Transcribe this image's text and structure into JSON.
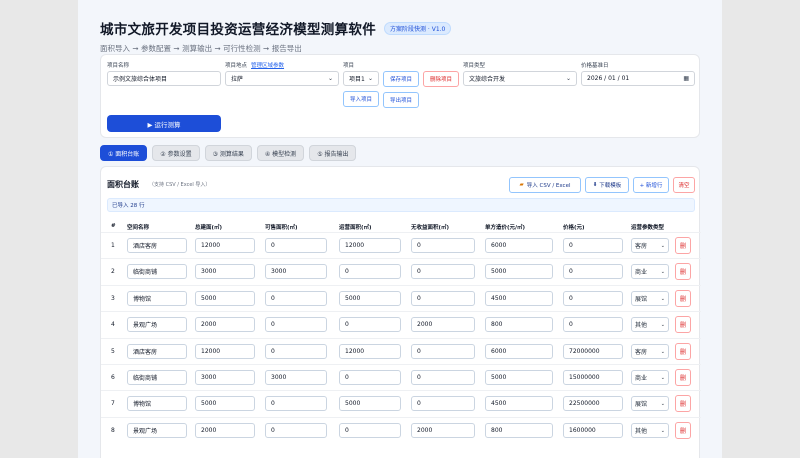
{
  "header": {
    "title": "城市文旅开发项目投资运营经济模型测算软件",
    "version": "方案阶段快测 · V1.0",
    "subtitle": "面积导入 ➞ 参数配置 ➞ 测算输出 ➞ 可行性检测 ➞ 报告导出"
  },
  "form": {
    "project_name_label": "项目名称",
    "project_name_value": "示例文旅综合体项目",
    "region_label": "项目地点",
    "region_link": "管理区域参数",
    "region_value": "拉萨",
    "project_label": "项目",
    "project_value": "项目1",
    "save_label": "保存项目",
    "delete_label": "删除项目",
    "import_label": "导入项目",
    "export_label": "导出项目",
    "type_label": "项目类型",
    "type_value": "文旅综合开发",
    "date_label": "价格基准日",
    "date_value": "2026 / 01 / 01",
    "run_label": "▶ 运行测算"
  },
  "tabs": [
    {
      "label": "① 面积台账",
      "active": true
    },
    {
      "label": "② 参数设置",
      "active": false
    },
    {
      "label": "③ 测算结果",
      "active": false
    },
    {
      "label": "④ 模型检测",
      "active": false
    },
    {
      "label": "⑤ 报告输出",
      "active": false
    }
  ],
  "table": {
    "title": "面积台账",
    "hint": "（支持 CSV / Excel 导入）",
    "import_btn": "导入 CSV / Excel",
    "template_btn": "下载模板",
    "add_btn": "+ 新增行",
    "clear_btn": "清空",
    "imported_msg": "已导入 28 行",
    "columns": [
      "#",
      "空间名称",
      "总建面(㎡)",
      "可售面积(㎡)",
      "运营面积(㎡)",
      "无收益面积(㎡)",
      "单方造价(元/㎡)",
      "价格(元)",
      "运营参数类型",
      ""
    ],
    "delete_label": "删",
    "rows": [
      {
        "no": "1",
        "name": "酒店客房",
        "gfa": "12000",
        "sale": "0",
        "op": "12000",
        "non": "0",
        "cost": "6000",
        "price": "0",
        "type": "客房"
      },
      {
        "no": "2",
        "name": "临街商铺",
        "gfa": "3000",
        "sale": "3000",
        "op": "0",
        "non": "0",
        "cost": "5000",
        "price": "0",
        "type": "商业"
      },
      {
        "no": "3",
        "name": "博物馆",
        "gfa": "5000",
        "sale": "0",
        "op": "5000",
        "non": "0",
        "cost": "4500",
        "price": "0",
        "type": "展馆"
      },
      {
        "no": "4",
        "name": "景观广场",
        "gfa": "2000",
        "sale": "0",
        "op": "0",
        "non": "2000",
        "cost": "800",
        "price": "0",
        "type": "其他"
      },
      {
        "no": "5",
        "name": "酒店客房",
        "gfa": "12000",
        "sale": "0",
        "op": "12000",
        "non": "0",
        "cost": "6000",
        "price": "72000000",
        "type": "客房"
      },
      {
        "no": "6",
        "name": "临街商铺",
        "gfa": "3000",
        "sale": "3000",
        "op": "0",
        "non": "0",
        "cost": "5000",
        "price": "15000000",
        "type": "商业"
      },
      {
        "no": "7",
        "name": "博物馆",
        "gfa": "5000",
        "sale": "0",
        "op": "5000",
        "non": "0",
        "cost": "4500",
        "price": "22500000",
        "type": "展馆"
      },
      {
        "no": "8",
        "name": "景观广场",
        "gfa": "2000",
        "sale": "0",
        "op": "0",
        "non": "2000",
        "cost": "800",
        "price": "1600000",
        "type": "其他"
      }
    ]
  }
}
